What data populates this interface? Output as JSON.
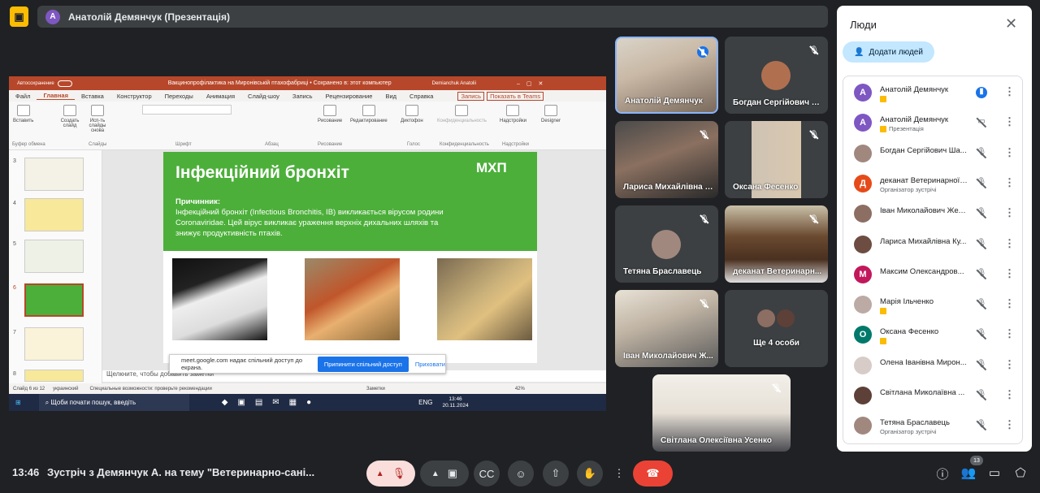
{
  "presenter_bar": {
    "avatar": "А",
    "text": "Анатолій Демянчук (Презентація)"
  },
  "ppt": {
    "autosave": "Автосохранение",
    "title": "Вакцинопрофілактика на Миронівській птахофабриці • Сохранено в: этот компьютер",
    "user": "Demianchuk Anatolii",
    "menu": [
      "Файл",
      "Главная",
      "Вставка",
      "Конструктор",
      "Переходы",
      "Анимация",
      "Слайд-шоу",
      "Запись",
      "Рецензирование",
      "Вид",
      "Справка"
    ],
    "record_btn": "Запись",
    "teams_btn": "Показать в Teams",
    "ribbon": {
      "paste": "Вставить",
      "create": "Создать слайд",
      "reuse": "Исп-ть слайды снова",
      "draw": "Рисование",
      "editing": "Редактирование",
      "dictation": "Диктофон",
      "privacy": "Конфиденциальность",
      "addins": "Надстройки",
      "designer": "Designer",
      "groups": [
        "Буфер обмена",
        "Слайды",
        "Шрифт",
        "Абзац",
        "Рисование",
        "Голос",
        "Конфиденциальность",
        "Надстройки"
      ]
    },
    "slide_numbers": [
      "3",
      "4",
      "5",
      "6",
      "7",
      "8"
    ],
    "slide": {
      "title": "Інфекційний бронхіт",
      "logo": "МХП",
      "heading": "Причинник:",
      "body": "Інфекційний бронхіт (Infectious Bronchitis, IB) викликається вірусом родини Coronaviridae. Цей вірус викликає ураження верхніх дихальних шляхів та знижує продуктивність птахів."
    },
    "notes": "Щелкните, чтобы добавить заметки",
    "status": {
      "slide": "Слайд 6 из 12",
      "lang": "украинский",
      "accessibility": "Специальные возможности: проверьте рекомендации",
      "notes": "Заметки",
      "zoom": "42%"
    },
    "share": {
      "text": "meet.google.com надає спільний доступ до екрана.",
      "button": "Припинити спільний доступ",
      "hide": "Приховати"
    },
    "taskbar": {
      "search": "Щоби почати пошук, введіть",
      "lang": "ENG",
      "time": "13:46",
      "date": "20.11.2024"
    }
  },
  "tiles": [
    {
      "name": "Анатолій Демянчук",
      "speaking": true
    },
    {
      "name": "Богдан Сергійович Ш..."
    },
    {
      "name": "Лариса Михайлівна К..."
    },
    {
      "name": "Оксана Фесенко"
    },
    {
      "name": "Тетяна Браславець"
    },
    {
      "name": "деканат Ветеринарн..."
    },
    {
      "name": "Іван Миколайович Ж..."
    },
    {
      "name": "Ще 4 особи"
    },
    {
      "name": "Світлана Олексіївна Усенко"
    }
  ],
  "people": {
    "title": "Люди",
    "add": "Додати людей",
    "list": [
      {
        "name": "Анатолій Демянчук",
        "sub": "",
        "avatar": "А",
        "color": "#7e57c2",
        "mic": "on",
        "pin": true
      },
      {
        "name": "Анатолій Демянчук",
        "sub": "Презентація",
        "avatar": "А",
        "color": "#7e57c2",
        "mic": "present",
        "pin": true
      },
      {
        "name": "Богдан Сергійович Ша...",
        "sub": "",
        "avatar": "",
        "color": "#a1887f",
        "mic": "off"
      },
      {
        "name": "деканат Ветеринарної ...",
        "sub": "Організатор зустрічі",
        "avatar": "Д",
        "color": "#e64a19",
        "mic": "off"
      },
      {
        "name": "Іван Миколайович Жел...",
        "sub": "",
        "avatar": "",
        "color": "#8d6e63",
        "mic": "off"
      },
      {
        "name": "Лариса Михайлівна Ку...",
        "sub": "",
        "avatar": "",
        "color": "#6d4c41",
        "mic": "off"
      },
      {
        "name": "Максим Олександров...",
        "sub": "",
        "avatar": "М",
        "color": "#c2185b",
        "mic": "off"
      },
      {
        "name": "Марія Ільченко",
        "sub": "",
        "avatar": "",
        "color": "#bcaaa4",
        "mic": "off",
        "pin": true
      },
      {
        "name": "Оксана Фесенко",
        "sub": "",
        "avatar": "О",
        "color": "#00796b",
        "mic": "off",
        "pin": true
      },
      {
        "name": "Олена Іванівна Мирон...",
        "sub": "",
        "avatar": "",
        "color": "#d7ccc8",
        "mic": "off"
      },
      {
        "name": "Світлана Миколаївна ...",
        "sub": "",
        "avatar": "",
        "color": "#5d4037",
        "mic": "off"
      },
      {
        "name": "Тетяна Браславець",
        "sub": "Організатор зустрічі",
        "avatar": "",
        "color": "#a1887f",
        "mic": "off"
      }
    ]
  },
  "bottom": {
    "time": "13:46",
    "title": "Зустріч з Демянчук А. на тему \"Ветеринарно-сані...",
    "participants_count": "13"
  }
}
